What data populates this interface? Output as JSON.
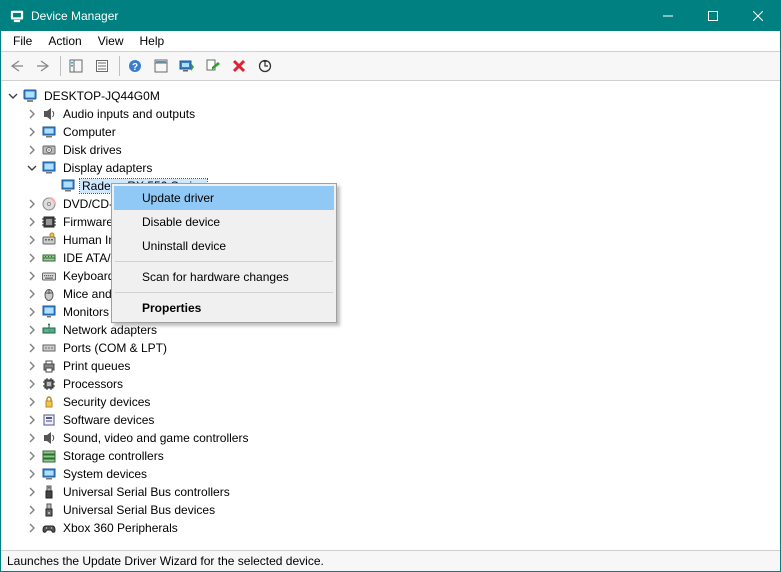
{
  "window": {
    "title": "Device Manager"
  },
  "menu": {
    "file": "File",
    "action": "Action",
    "view": "View",
    "help": "Help"
  },
  "toolbar_icons": [
    "back-icon",
    "forward-icon",
    "show-hide-tree-icon",
    "properties-icon",
    "help-icon",
    "enable-icon",
    "update-driver-icon",
    "uninstall-icon",
    "disable-icon",
    "scan-hardware-icon"
  ],
  "tree": {
    "root": "DESKTOP-JQ44G0M",
    "nodes": [
      {
        "label": "Audio inputs and outputs",
        "icon": "speaker-icon"
      },
      {
        "label": "Computer",
        "icon": "computer-icon"
      },
      {
        "label": "Disk drives",
        "icon": "disk-icon"
      },
      {
        "label": "Display adapters",
        "icon": "display-icon",
        "expanded": true,
        "children": [
          {
            "label": "Radeon RX 550 Series",
            "icon": "display-icon",
            "selected": true
          }
        ]
      },
      {
        "label": "DVD/CD-ROM drives",
        "icon": "dvd-icon"
      },
      {
        "label": "Firmware",
        "icon": "firmware-icon"
      },
      {
        "label": "Human Interface Devices",
        "icon": "hid-icon"
      },
      {
        "label": "IDE ATA/ATAPI controllers",
        "icon": "ide-icon"
      },
      {
        "label": "Keyboards",
        "icon": "keyboard-icon"
      },
      {
        "label": "Mice and other pointing devices",
        "icon": "mouse-icon"
      },
      {
        "label": "Monitors",
        "icon": "monitor-icon"
      },
      {
        "label": "Network adapters",
        "icon": "network-icon"
      },
      {
        "label": "Ports (COM & LPT)",
        "icon": "ports-icon"
      },
      {
        "label": "Print queues",
        "icon": "printer-icon"
      },
      {
        "label": "Processors",
        "icon": "processor-icon"
      },
      {
        "label": "Security devices",
        "icon": "security-icon"
      },
      {
        "label": "Software devices",
        "icon": "software-icon"
      },
      {
        "label": "Sound, video and game controllers",
        "icon": "sound-icon"
      },
      {
        "label": "Storage controllers",
        "icon": "storage-icon"
      },
      {
        "label": "System devices",
        "icon": "system-icon"
      },
      {
        "label": "Universal Serial Bus controllers",
        "icon": "usb-icon"
      },
      {
        "label": "Universal Serial Bus devices",
        "icon": "usb-device-icon"
      },
      {
        "label": "Xbox 360 Peripherals",
        "icon": "xbox-icon"
      }
    ]
  },
  "context_menu": {
    "items": [
      {
        "label": "Update driver",
        "highlight": true
      },
      {
        "label": "Disable device"
      },
      {
        "label": "Uninstall device"
      },
      {
        "sep": true
      },
      {
        "label": "Scan for hardware changes"
      },
      {
        "sep": true
      },
      {
        "label": "Properties",
        "bold": true
      }
    ]
  },
  "statusbar": {
    "text": "Launches the Update Driver Wizard for the selected device."
  }
}
